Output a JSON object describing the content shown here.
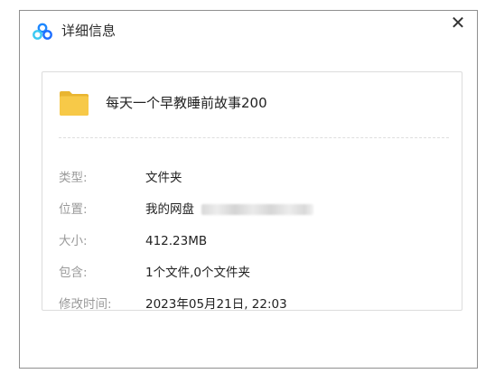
{
  "dialog": {
    "title": "详细信息",
    "close_glyph": "✕"
  },
  "icons": {
    "app_logo": "cloud-logo-icon",
    "folder": "folder-icon",
    "close": "close-icon"
  },
  "colors": {
    "folder_yellow": "#f7c948",
    "logo_blue": "#1e88ff",
    "logo_cyan": "#3bc9f2",
    "label_gray": "#9a9a9a"
  },
  "file": {
    "name": "每天一个早教睡前故事200"
  },
  "details": [
    {
      "label": "类型:",
      "value": "文件夹"
    },
    {
      "label": "位置:",
      "value": "我的网盘"
    },
    {
      "label": "大小:",
      "value": "412.23MB"
    },
    {
      "label": "包含:",
      "value": "1个文件,0个文件夹"
    },
    {
      "label": "修改时间:",
      "value": "2023年05月21日, 22:03"
    }
  ]
}
